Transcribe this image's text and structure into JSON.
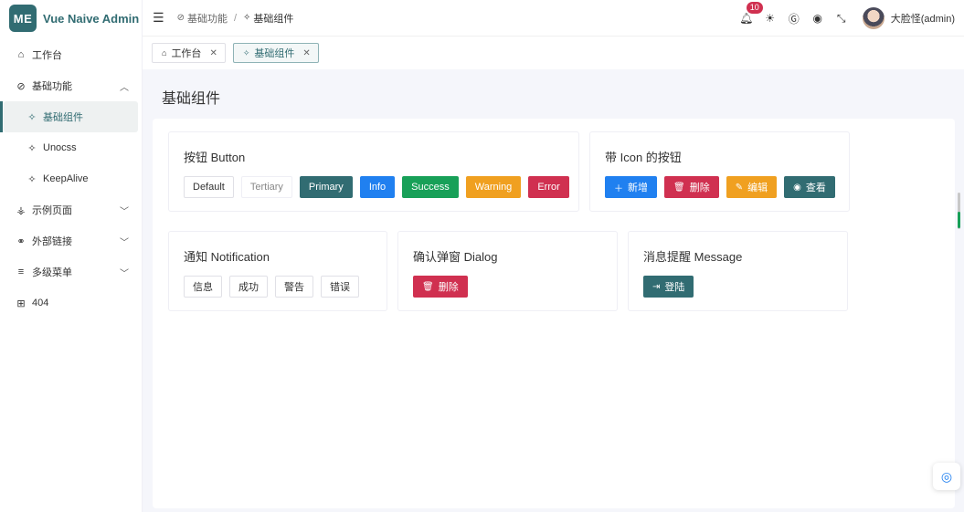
{
  "brand": {
    "logo_text": "ME",
    "name": "Vue Naive Admin",
    "color": "#316c72"
  },
  "sidebar": {
    "items": [
      {
        "label": "工作台",
        "icon": "home-icon",
        "glyph": "⌂"
      },
      {
        "label": "基础功能",
        "icon": "compass-icon",
        "glyph": "⊘",
        "expanded": true
      },
      {
        "label": "基础组件",
        "icon": "sparkle-icon",
        "glyph": "✧",
        "active": true
      },
      {
        "label": "Unocss",
        "icon": "sparkle-icon",
        "glyph": "✧"
      },
      {
        "label": "KeepAlive",
        "icon": "sparkle-icon",
        "glyph": "✧"
      },
      {
        "label": "示例页面",
        "icon": "run-icon",
        "glyph": "⚶",
        "expanded": false
      },
      {
        "label": "外部链接",
        "icon": "link-icon",
        "glyph": "⚭",
        "expanded": false
      },
      {
        "label": "多级菜单",
        "icon": "menu-icon",
        "glyph": "≡",
        "expanded": false
      },
      {
        "label": "404",
        "icon": "error-icon",
        "glyph": "⊞"
      }
    ]
  },
  "header": {
    "breadcrumb": [
      {
        "label": "基础功能",
        "icon": "compass-icon",
        "glyph": "⊘"
      },
      {
        "label": "基础组件",
        "icon": "sparkle-icon",
        "glyph": "✧"
      }
    ],
    "notification_count": "10",
    "username": "大脸怪(admin)"
  },
  "tabs": [
    {
      "label": "工作台",
      "icon": "home-icon",
      "glyph": "⌂",
      "active": false
    },
    {
      "label": "基础组件",
      "icon": "sparkle-icon",
      "glyph": "✧",
      "active": true
    }
  ],
  "page_title": "基础组件",
  "cards": {
    "button": {
      "title": "按钮 Button",
      "buttons": [
        "Default",
        "Tertiary",
        "Primary",
        "Info",
        "Success",
        "Warning",
        "Error"
      ]
    },
    "icon_button": {
      "title": "带 Icon 的按钮",
      "buttons": [
        {
          "label": "新增",
          "icon": "plus-icon"
        },
        {
          "label": "删除",
          "icon": "trash-icon"
        },
        {
          "label": "编辑",
          "icon": "edit-icon"
        },
        {
          "label": "查看",
          "icon": "eye-icon"
        }
      ]
    },
    "notification": {
      "title": "通知 Notification",
      "buttons": [
        "信息",
        "成功",
        "警告",
        "错误"
      ]
    },
    "dialog": {
      "title": "确认弹窗 Dialog",
      "button": {
        "label": "删除",
        "icon": "trash-icon"
      }
    },
    "message": {
      "title": "消息提醒 Message",
      "button": {
        "label": "登陆",
        "icon": "login-icon"
      }
    }
  },
  "colors": {
    "primary": "#316c72",
    "info": "#2080f0",
    "success": "#18a058",
    "warning": "#f0a020",
    "error": "#d03050"
  }
}
